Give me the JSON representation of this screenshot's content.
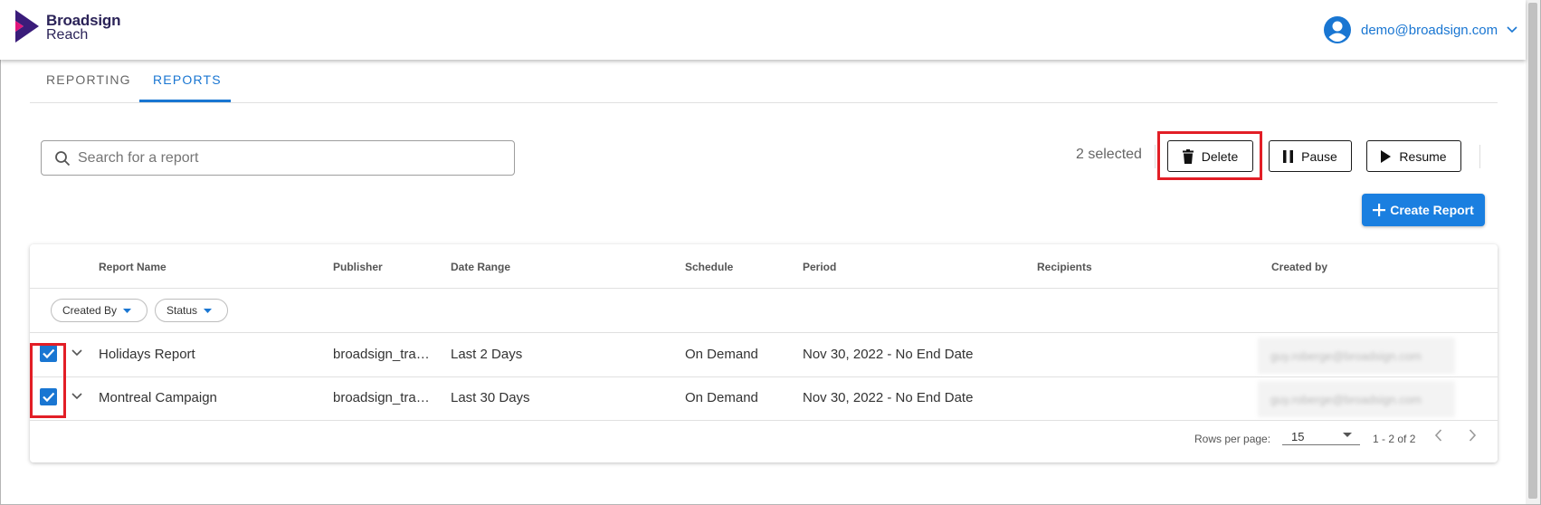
{
  "header": {
    "logo_line1": "Broadsign",
    "logo_line2": "Reach",
    "user_email": "demo@broadsign.com"
  },
  "tabs": [
    {
      "label": "REPORTING",
      "active": false
    },
    {
      "label": "REPORTS",
      "active": true
    }
  ],
  "search": {
    "placeholder": "Search for a report",
    "value": ""
  },
  "actions": {
    "selected_count": "2 selected",
    "delete_label": "Delete",
    "pause_label": "Pause",
    "resume_label": "Resume",
    "create_label": "Create Report"
  },
  "table": {
    "columns": [
      "Report Name",
      "Publisher",
      "Date Range",
      "Schedule",
      "Period",
      "Recipients",
      "Created by"
    ],
    "filters": {
      "created_by": "Created By",
      "status": "Status"
    },
    "rows": [
      {
        "checked": true,
        "name": "Holidays Report",
        "publisher": "broadsign_tra…",
        "date_range": "Last 2 Days",
        "schedule": "On Demand",
        "period": "Nov 30, 2022 - No End Date",
        "recipients": "",
        "created_by": "guy.roberge@broadsign.com"
      },
      {
        "checked": true,
        "name": "Montreal Campaign",
        "publisher": "broadsign_tra…",
        "date_range": "Last 30 Days",
        "schedule": "On Demand",
        "period": "Nov 30, 2022 - No End Date",
        "recipients": "",
        "created_by": "guy.roberge@broadsign.com"
      }
    ],
    "footer": {
      "rows_per_page_label": "Rows per page:",
      "rows_per_page_value": "15",
      "range": "1 - 2 of 2"
    }
  },
  "colors": {
    "accent": "#1976d2",
    "brand_purple": "#3a1c7a",
    "highlight_red": "#e21e26"
  }
}
